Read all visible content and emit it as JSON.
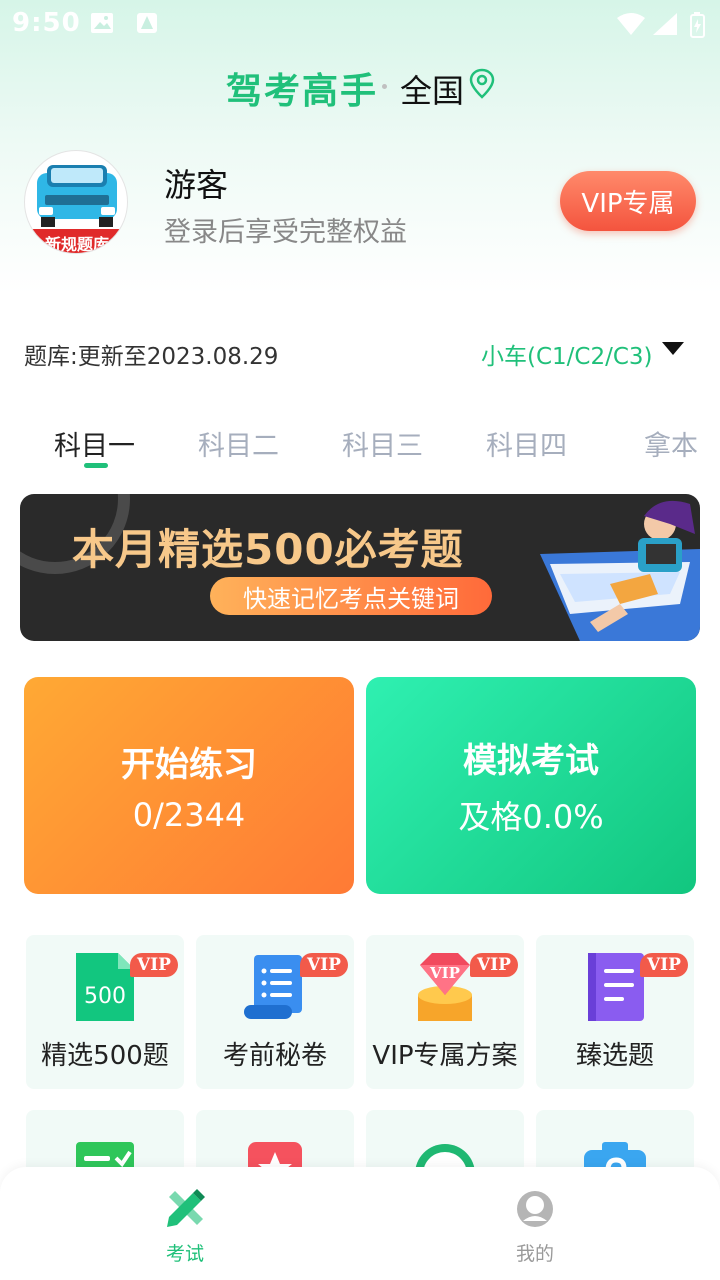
{
  "status_bar": {
    "time": "9:50"
  },
  "header": {
    "title": "驾考高手",
    "region": "全国"
  },
  "profile": {
    "avatar_badge": "新规题库",
    "name": "游客",
    "subtitle": "登录后享受完整权益",
    "vip_button": "VIP专属"
  },
  "bank": {
    "info": "题库:更新至2023.08.29",
    "car_type": "小车(C1/C2/C3)"
  },
  "tabs": [
    {
      "label": "科目一"
    },
    {
      "label": "科目二"
    },
    {
      "label": "科目三"
    },
    {
      "label": "科目四"
    },
    {
      "label": "拿本"
    }
  ],
  "banner": {
    "title": "本月精选500必考题",
    "subtitle": "快速记忆考点关键词"
  },
  "cards": {
    "practice": {
      "title": "开始练习",
      "value": "0/2344"
    },
    "exam": {
      "title": "模拟考试",
      "value": "及格0.0%"
    }
  },
  "features": [
    {
      "label": "精选500题",
      "tag": "VIP",
      "icon": "500-doc-icon",
      "icon_text": "500"
    },
    {
      "label": "考前秘卷",
      "tag": "VIP",
      "icon": "scroll-icon"
    },
    {
      "label": "VIP专属方案",
      "tag": "VIP",
      "icon": "vip-gem-icon",
      "icon_text": "VIP"
    },
    {
      "label": "臻选题",
      "tag": "VIP",
      "icon": "notebook-icon"
    }
  ],
  "nav": {
    "exam": "考试",
    "mine": "我的"
  },
  "colors": {
    "brand_green": "#20c07a",
    "vip_red": "#f25a4a",
    "practice_orange": "#ff8a35",
    "exam_green": "#18d08a"
  }
}
